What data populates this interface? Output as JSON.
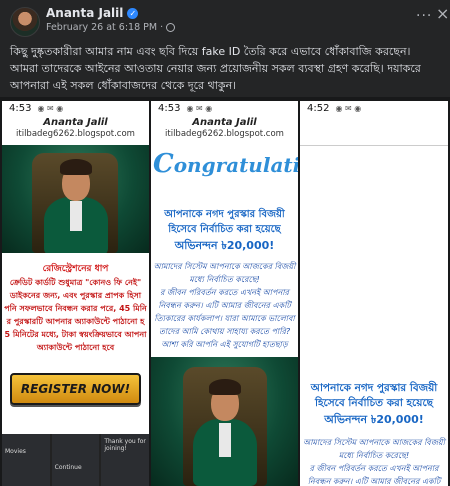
{
  "post": {
    "author": "Ananta Jalil",
    "timestamp": "February 26 at 6:18 PM",
    "separator": "·",
    "text": "কিছু দুষ্কৃতকারীরা আমার নাম এবং ছবি দিয়ে fake ID তৈরি করে এভাবে ধোঁকাবাজি করছেন। আমরা তাদেরকে আইনের আওতায় নেয়ার জন্য প্রয়োজনীয় সকল ব্যবস্থা গ্রহণ করেছি। দয়াকরে আপনারা এই সকল ধোঁকাবাজদের থেকে দূরে থাকুন।"
  },
  "screenshot1": {
    "time": "4:53",
    "page_title": "Ananta Jalil",
    "url": "itilbadeg6262.blogspot.com",
    "heading": "রেজিস্ট্রেশনের ধাপ",
    "lines": [
      "ক্রেডিট কার্ডটি শুধুমাত্র \"কোনও ফি নেই\"",
      "ডাইকনের জন্য, এবং পুরস্কার প্রাপক হিসা",
      "পনি সফলভাবে নিবন্ধন করার পরে, 45 মিনি",
      "র পুরস্কারটি আপনার অ্যাকাউন্টে পাঠানো হ",
      "5 মিনিটের মধ্যে, টাকা স্বয়ংক্রিয়ভাবে আপনা",
      "অ্যাকাউন্টে পাঠানো হবে"
    ],
    "button": "REGISTER NOW!",
    "thumb_labels": [
      "Movies",
      "Continue",
      "Thank you for joining!"
    ]
  },
  "screenshot2": {
    "time": "4:53",
    "page_title": "Ananta Jalil",
    "url": "itilbadeg6262.blogspot.com",
    "congrats": "ongratulation-",
    "prize_lines": [
      "আপনাকে নগদ পুরস্কার বিজয়ী",
      "হিসেবে নির্বাচিত করা হয়েছে",
      "অভিনন্দন ৳20,000!"
    ],
    "body_lines": [
      "আমাদের সিস্টেম আপনাকে আজকের বিজয়ী",
      "মধ্যে নির্বাচিত করেছে!",
      "র জীবন পরিবর্তন করতে এখনই আপনার",
      "নিবন্ধন করুন। এটি আমার জীবনের একটি",
      "ত্যিকারের কার্যকলাপ। যারা আমাকে ভালোবা",
      "তাদের আমি কোথায় সাহায্য করতে পারি?",
      "আশা করি আপনি এই সুযোগটি হাতছাড়"
    ]
  },
  "screenshot3": {
    "time": "4:52",
    "prize_lines": [
      "আপনাকে নগদ পুরস্কার বিজয়ী",
      "হিসেবে নির্বাচিত করা হয়েছে",
      "অভিনন্দন ৳20,000!"
    ],
    "body_lines": [
      "আমাদের সিস্টেম আপনাকে আজকের বিজয়ী",
      "মধ্যে নির্বাচিত করেছে!",
      "র জীবন পরিবর্তন করতে এখনই আপনার",
      "নিবন্ধন করুন। এটি আমার জীবনের একটি"
    ]
  }
}
